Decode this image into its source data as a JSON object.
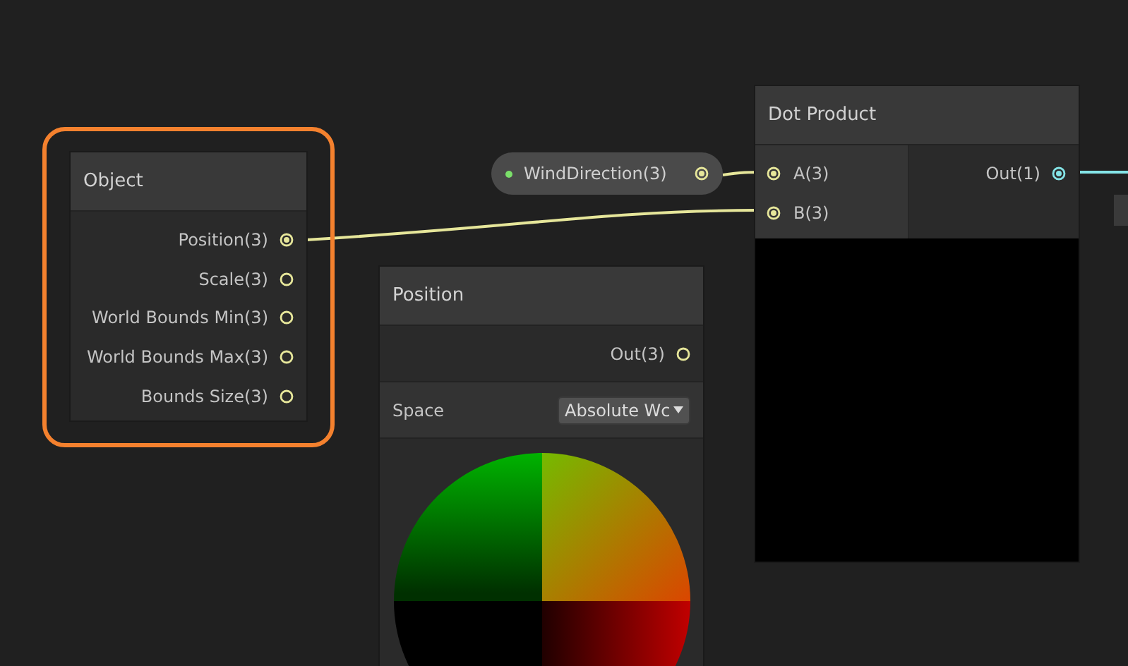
{
  "nodes": [
    {
      "kind": "ports",
      "title": "Object",
      "selected": true,
      "outputs": [
        {
          "label": "Position(3)",
          "connected": true,
          "color": "#e6e69a"
        },
        {
          "label": "Scale(3)",
          "connected": false,
          "color": "#e6e69a"
        },
        {
          "label": "World Bounds Min(3)",
          "connected": false,
          "color": "#e6e69a"
        },
        {
          "label": "World Bounds Max(3)",
          "connected": false,
          "color": "#e6e69a"
        },
        {
          "label": "Bounds Size(3)",
          "connected": false,
          "color": "#e6e69a"
        }
      ]
    },
    {
      "kind": "position",
      "title": "Position",
      "selected": false,
      "outputs": [
        {
          "label": "Out(3)",
          "connected": false,
          "color": "#e6e69a"
        }
      ],
      "setting": {
        "label": "Space",
        "value": "Absolute Wc"
      }
    },
    {
      "kind": "dot",
      "title": "Dot Product",
      "selected": false,
      "inputs": [
        {
          "label": "A(3)",
          "connected": true,
          "color": "#e6e69a"
        },
        {
          "label": "B(3)",
          "connected": true,
          "color": "#e6e69a"
        }
      ],
      "outputs": [
        {
          "label": "Out(1)",
          "connected": true,
          "color": "#84e4e7"
        }
      ]
    }
  ],
  "property": {
    "label": "WindDirection(3)",
    "connected": true,
    "color": "#e6e69a"
  }
}
